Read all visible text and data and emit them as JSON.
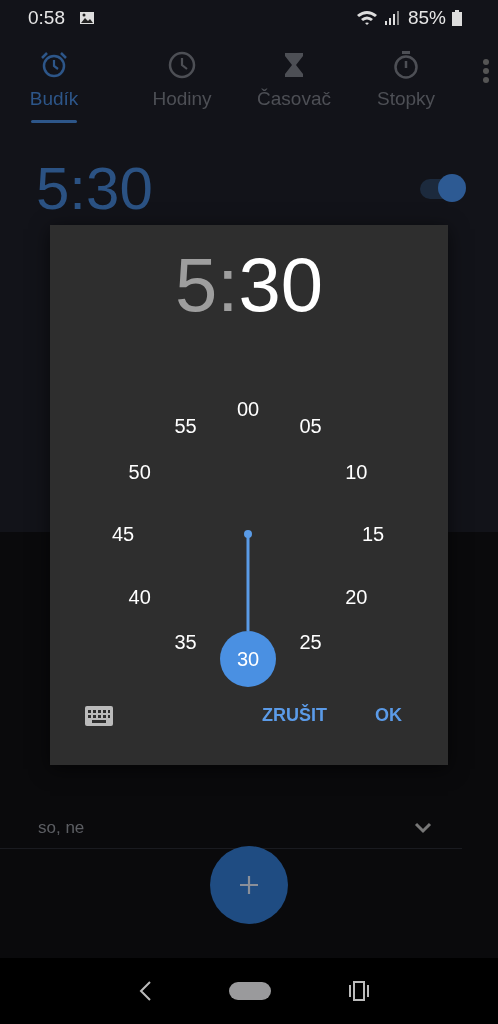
{
  "status_bar": {
    "time": "0:58",
    "battery": "85%"
  },
  "tabs": [
    {
      "label": "Budík",
      "kind": "alarm",
      "selected": true
    },
    {
      "label": "Hodiny",
      "kind": "clock",
      "selected": false
    },
    {
      "label": "Časovač",
      "kind": "timer",
      "selected": false
    },
    {
      "label": "Stopky",
      "kind": "stopwatch",
      "selected": false
    }
  ],
  "alarm": {
    "time": "5:30",
    "on": true
  },
  "second_alarm": {
    "days": "so, ne",
    "expanded": false
  },
  "time_picker": {
    "hour": {
      "text": "5",
      "selected": false
    },
    "separator": ":",
    "minute": {
      "text": "30",
      "selected": true
    },
    "dial": [
      {
        "label": "00",
        "selected": false
      },
      {
        "label": "05",
        "selected": false
      },
      {
        "label": "10",
        "selected": false
      },
      {
        "label": "15",
        "selected": false
      },
      {
        "label": "20",
        "selected": false
      },
      {
        "label": "25",
        "selected": false
      },
      {
        "label": "30",
        "selected": true
      },
      {
        "label": "35",
        "selected": false
      },
      {
        "label": "40",
        "selected": false
      },
      {
        "label": "45",
        "selected": false
      },
      {
        "label": "50",
        "selected": false
      },
      {
        "label": "55",
        "selected": false
      }
    ],
    "buttons": [
      {
        "label": "ZRUŠIT"
      },
      {
        "label": "OK"
      }
    ]
  }
}
